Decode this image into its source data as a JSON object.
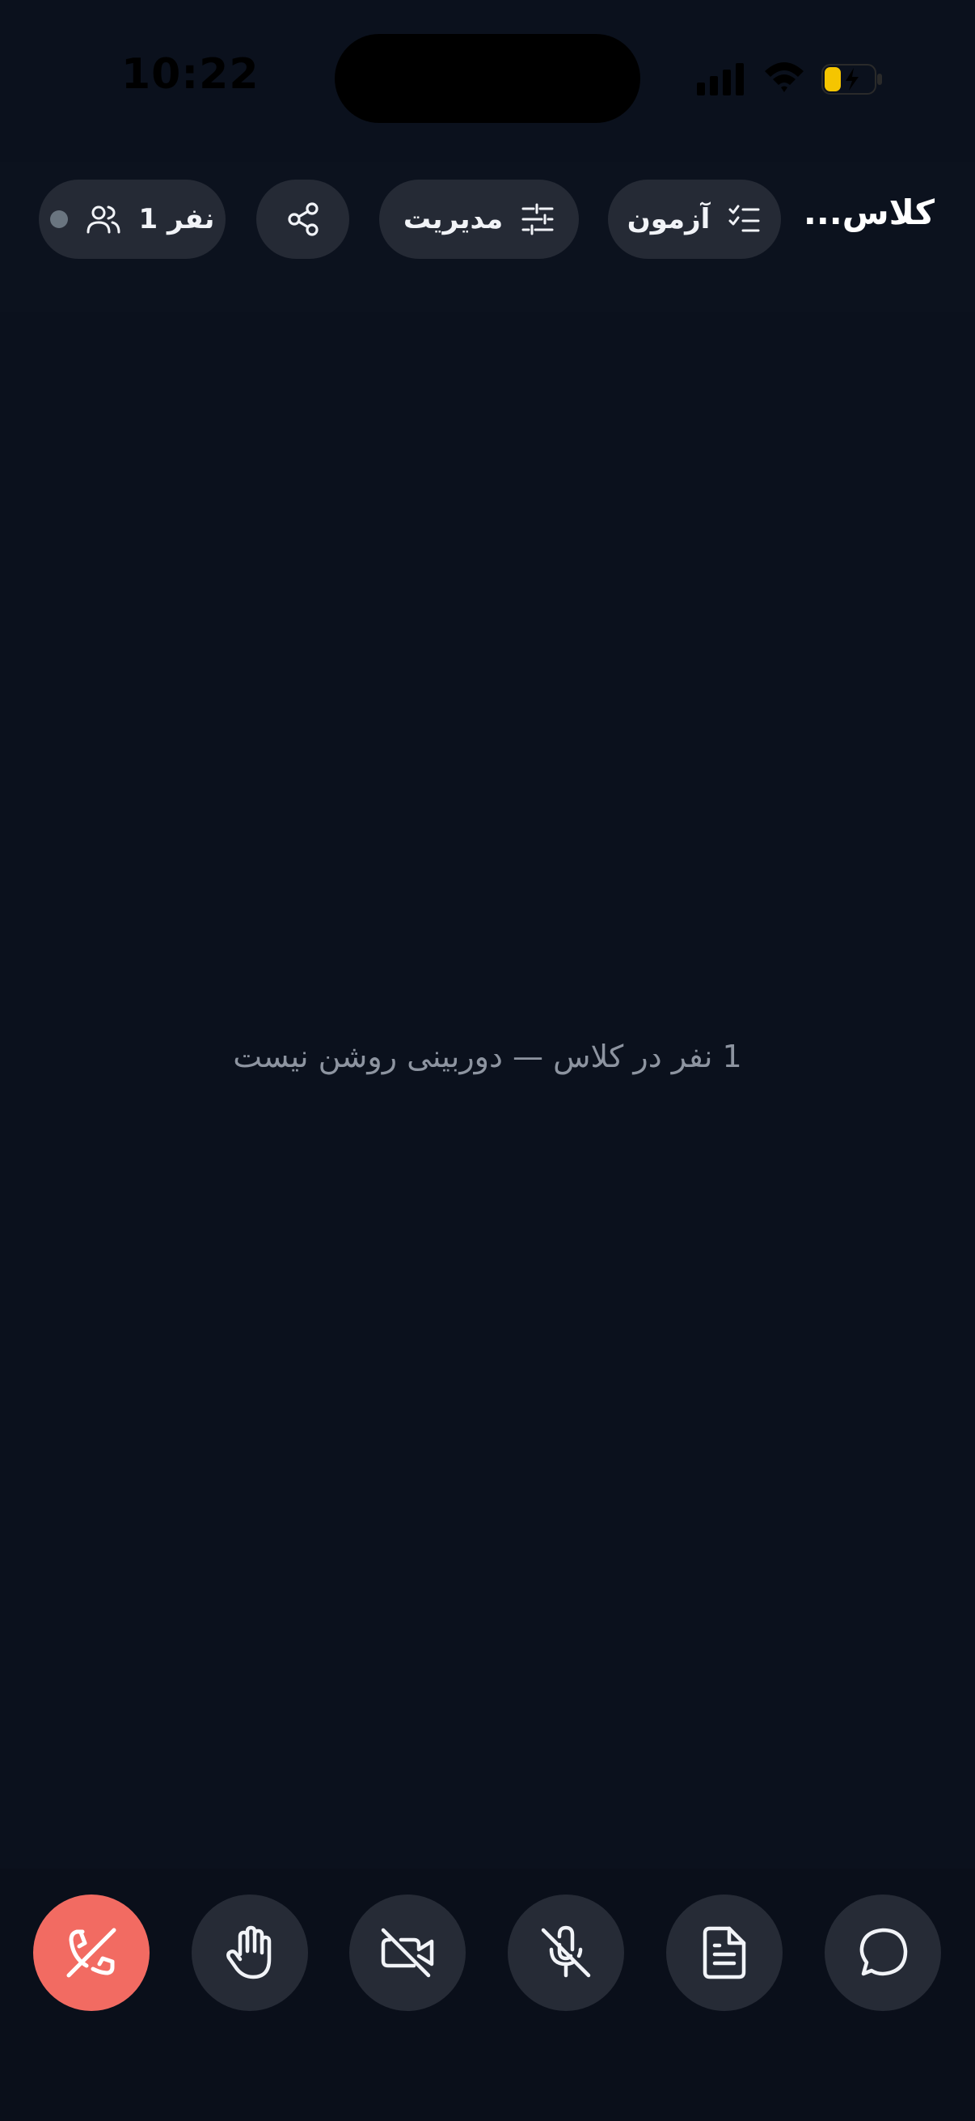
{
  "status_bar": {
    "time": "10:22",
    "battery_color": "#f5c500"
  },
  "header": {
    "title": "کلاس...",
    "exam_label": "آزمون",
    "manage_label": "مدیریت",
    "participants_label": "1 نفر"
  },
  "main": {
    "empty_message": "1 نفر در کلاس — دوربینی روشن نیست"
  },
  "controls": [
    {
      "name": "leave-call",
      "icon": "phone-off-icon",
      "color": "#f26b62"
    },
    {
      "name": "raise-hand",
      "icon": "hand-icon"
    },
    {
      "name": "camera-toggle",
      "icon": "video-off-icon"
    },
    {
      "name": "mic-toggle",
      "icon": "mic-off-icon"
    },
    {
      "name": "document",
      "icon": "document-icon"
    },
    {
      "name": "chat",
      "icon": "chat-icon"
    }
  ]
}
